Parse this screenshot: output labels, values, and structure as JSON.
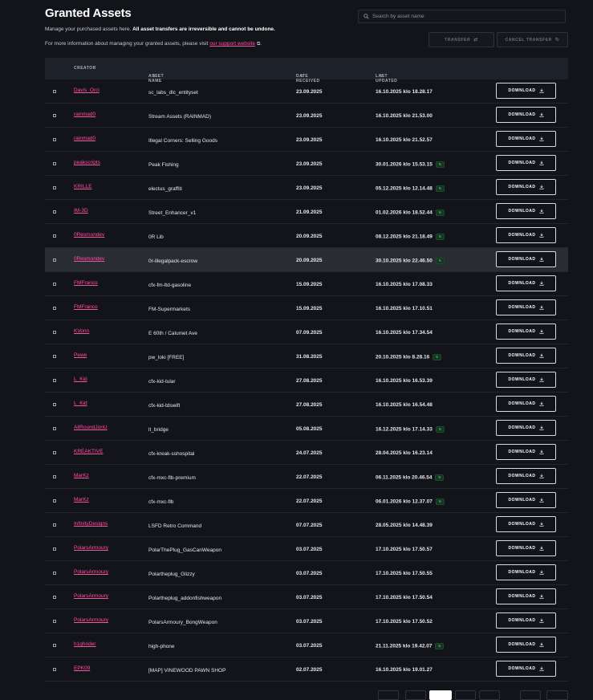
{
  "header": {
    "title": "Granted Assets",
    "desc_plain": "Manage your purchased assets here. ",
    "desc_bold": "All asset transfers are irreversible and cannot be undone.",
    "info_prefix": "For more information about managing your granted assets, please visit ",
    "info_link": "our support website",
    "info_suffix": "."
  },
  "search": {
    "placeholder": "Search by asset name"
  },
  "actions": {
    "transfer": "TRANSFER",
    "cancel_transfer": "CANCEL TRANSFER"
  },
  "table": {
    "columns": {
      "creator": "CREATOR",
      "asset_name": "ASSET NAME",
      "date_received": "DATE RECEIVED",
      "last_updated": "LAST UPDATED"
    },
    "download_label": "DOWNLOAD",
    "rows": [
      {
        "creator": "Davis_Orci",
        "asset": "sc_labs_dlc_entityset",
        "date": "23.09.2025",
        "updated": "16.10.2025 klo 18.28.17",
        "badge": false
      },
      {
        "creator": "rainmad0",
        "asset": "Stream Assets (RAINMAD)",
        "date": "23.09.2025",
        "updated": "16.10.2025 klo 21.53.00",
        "badge": false
      },
      {
        "creator": "rainmad0",
        "asset": "Illegal Corners: Selling Goods",
        "date": "23.09.2025",
        "updated": "16.10.2025 klo 21.52.57",
        "badge": false
      },
      {
        "creator": "peakscripts",
        "asset": "Peak Fishing",
        "date": "23.09.2025",
        "updated": "30.01.2026 klo 15.53.15",
        "badge": true
      },
      {
        "creator": "KRILLE",
        "asset": "electus_graffiti",
        "date": "23.09.2025",
        "updated": "05.12.2025 klo 12.14.48",
        "badge": true
      },
      {
        "creator": "IM-3D",
        "asset": "Street_Enhancer_v1",
        "date": "21.09.2025",
        "updated": "01.02.2026 klo 18.52.44",
        "badge": true
      },
      {
        "creator": "0Resmondev",
        "asset": "0R Lib",
        "date": "20.09.2025",
        "updated": "08.12.2025 klo 21.18.49",
        "badge": true
      },
      {
        "creator": "0Resmondev",
        "asset": "0r-illegalpack-escrow",
        "date": "20.09.2025",
        "updated": "30.10.2025 klo 22.46.50",
        "badge": true
      },
      {
        "creator": "FMFranco",
        "asset": "cfx-fm-ltd-gasoline",
        "date": "15.09.2025",
        "updated": "16.10.2025 klo 17.08.33",
        "badge": false
      },
      {
        "creator": "FMFranco",
        "asset": "FM-Supermarkets",
        "date": "15.09.2025",
        "updated": "16.10.2025 klo 17.10.51",
        "badge": false
      },
      {
        "creator": "KVonn",
        "asset": "E 60th / Calumet Ave",
        "date": "07.09.2025",
        "updated": "16.10.2025 klo 17.34.54",
        "badge": false
      },
      {
        "creator": "Pewe",
        "asset": "pw_loki [FREE]",
        "date": "31.08.2025",
        "updated": "20.10.2025 klo 8.28.16",
        "badge": true
      },
      {
        "creator": "L_Kid",
        "asset": "cfx-kid-tular",
        "date": "27.08.2025",
        "updated": "16.10.2025 klo 16.53.39",
        "badge": false
      },
      {
        "creator": "L_Kid",
        "asset": "cfx-kid-tdswift",
        "date": "27.08.2025",
        "updated": "16.10.2025 klo 16.54.48",
        "badge": false
      },
      {
        "creator": "AllRoundJonU",
        "asset": "lt_bridge",
        "date": "05.08.2025",
        "updated": "16.12.2025 klo 17.14.33",
        "badge": true
      },
      {
        "creator": "KREAKTIVE",
        "asset": "cfx-kreak-sshospital",
        "date": "24.07.2025",
        "updated": "28.04.2025 klo 16.23.14",
        "badge": false
      },
      {
        "creator": "MarKz",
        "asset": "cfx-mxc-flb-premium",
        "date": "22.07.2025",
        "updated": "06.11.2025 klo 20.46.54",
        "badge": true
      },
      {
        "creator": "MarKz",
        "asset": "cfx-mxc-flb",
        "date": "22.07.2025",
        "updated": "06.01.2026 klo 12.37.07",
        "badge": true
      },
      {
        "creator": "InfinityDesigns",
        "asset": "LSFD Retro Command",
        "date": "07.07.2025",
        "updated": "28.05.2025 klo 14.48.39",
        "badge": false
      },
      {
        "creator": "PolarsArmoury",
        "asset": "PolarThePlug_GasCanWeapon",
        "date": "03.07.2025",
        "updated": "17.10.2025 klo 17.50.57",
        "badge": false
      },
      {
        "creator": "PolarsArmoury",
        "asset": "Polartheplug_Glizzy",
        "date": "03.07.2025",
        "updated": "17.10.2025 klo 17.50.55",
        "badge": false
      },
      {
        "creator": "PolarsArmoury",
        "asset": "Polartheplug_addonfishweapon",
        "date": "03.07.2025",
        "updated": "17.10.2025 klo 17.50.54",
        "badge": false
      },
      {
        "creator": "PolarsArmoury",
        "asset": "PolarsArmoury_BongWeapon",
        "date": "03.07.2025",
        "updated": "17.10.2025 klo 17.50.52",
        "badge": false
      },
      {
        "creator": "h1ghrider",
        "asset": "high-phone",
        "date": "03.07.2025",
        "updated": "21.11.2025 klo 19.42.07",
        "badge": true
      },
      {
        "creator": "EPK09",
        "asset": "[MAP] VINEWOOD PAWN SHOP",
        "date": "02.07.2025",
        "updated": "16.10.2025 klo 19.01.27",
        "badge": false
      }
    ],
    "highlighted_row": 7
  },
  "colors": {
    "accent_link": "#ff4fa3",
    "update_badge": "#3ccf6a",
    "background": "#121419",
    "header_row": "#1d212a"
  }
}
